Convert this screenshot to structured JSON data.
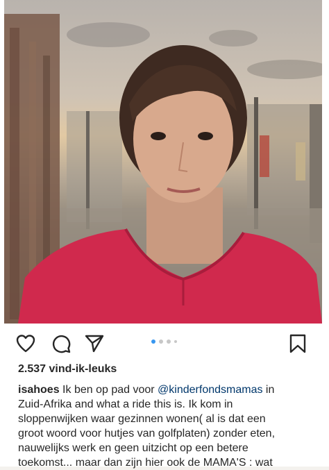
{
  "post": {
    "likes_text": "2.537 vind-ik-leuks",
    "username": "isahoes",
    "mention": "@kinderfondsmamas",
    "caption_lines": [
      "Ik ben op pad voor",
      "in",
      "Zuid-Afrika and what a ride this is. Ik kom in",
      "sloppenwijken waar gezinnen wonen( al is dat een",
      "groot woord voor hutjes van golfplaten) zonder eten,",
      "nauwelijks werk en geen uitzicht op een betere",
      "toekomst... maar dan zijn hier ook de MAMA'S : wat"
    ]
  },
  "carousel": {
    "total": 4,
    "active_index": 0
  },
  "actions": {
    "like_icon": "heart-icon",
    "comment_icon": "comment-icon",
    "share_icon": "send-icon",
    "save_icon": "bookmark-icon"
  },
  "colors": {
    "text": "#262626",
    "mention": "#00376b",
    "dot_active": "#3897f0",
    "dot_inactive": "#c7c7c7",
    "shirt": "#d0294d"
  }
}
